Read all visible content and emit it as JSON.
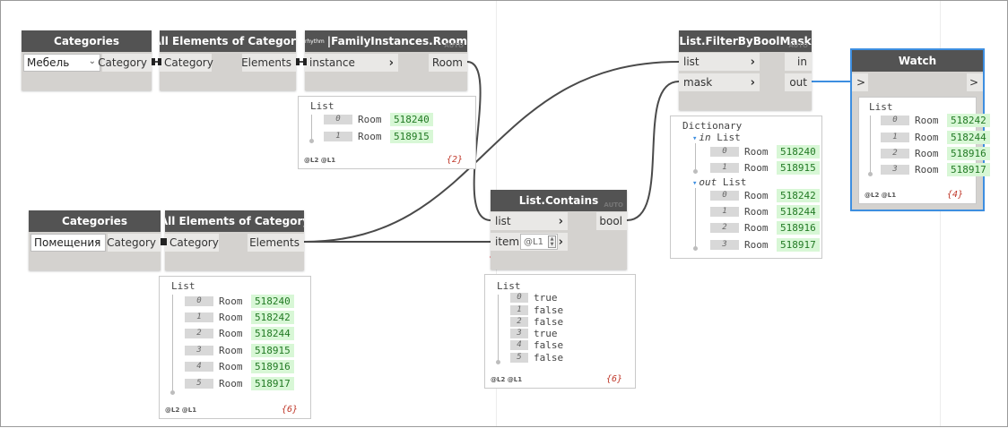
{
  "nodes": {
    "categories1": {
      "title": "Categories",
      "dropdown_value": "Мебель",
      "output_port": "Category"
    },
    "all_elements1": {
      "title": "All Elements of Category",
      "input_port": "Category",
      "output_port": "Elements"
    },
    "family_instances": {
      "title_prefix": "rhythm",
      "title": "|FamilyInstances.Room",
      "input_port": "instance",
      "output_port": "Room",
      "lacing": "AUTO"
    },
    "categories2": {
      "title": "Categories",
      "dropdown_value": "Помещения",
      "output_port": "Category"
    },
    "all_elements2": {
      "title": "All Elements of Category",
      "input_port": "Category",
      "output_port": "Elements"
    },
    "list_contains": {
      "title": "List.Contains",
      "input_port_list": "list",
      "input_port_item": "item",
      "item_lacing": "@L1",
      "output_port": "bool",
      "lacing": "AUTO"
    },
    "filter_by_bool_mask": {
      "title": "List.FilterByBoolMask",
      "input_port_list": "list",
      "input_port_mask": "mask",
      "output_port_in": "in",
      "output_port_out": "out",
      "lacing": "AUTO"
    },
    "watch": {
      "title": "Watch",
      "input_port": ">",
      "output_port": ">"
    }
  },
  "previews": {
    "family_instances": {
      "title": "List",
      "items": [
        {
          "index": "0",
          "label": "Room",
          "value": "518240"
        },
        {
          "index": "1",
          "label": "Room",
          "value": "518915"
        }
      ],
      "levels": "@L2 @L1",
      "count": "{2}"
    },
    "all_elements2": {
      "title": "List",
      "items": [
        {
          "index": "0",
          "label": "Room",
          "value": "518240"
        },
        {
          "index": "1",
          "label": "Room",
          "value": "518242"
        },
        {
          "index": "2",
          "label": "Room",
          "value": "518244"
        },
        {
          "index": "3",
          "label": "Room",
          "value": "518915"
        },
        {
          "index": "4",
          "label": "Room",
          "value": "518916"
        },
        {
          "index": "5",
          "label": "Room",
          "value": "518917"
        }
      ],
      "levels": "@L2 @L1",
      "count": "{6}"
    },
    "list_contains": {
      "title": "List",
      "items": [
        {
          "index": "0",
          "value": "true"
        },
        {
          "index": "1",
          "value": "false"
        },
        {
          "index": "2",
          "value": "false"
        },
        {
          "index": "3",
          "value": "true"
        },
        {
          "index": "4",
          "value": "false"
        },
        {
          "index": "5",
          "value": "false"
        }
      ],
      "levels": "@L2 @L1",
      "count": "{6}"
    },
    "filter_by_bool_mask": {
      "title": "Dictionary",
      "in_key": "in",
      "in_title": "List",
      "in_items": [
        {
          "index": "0",
          "label": "Room",
          "value": "518240"
        },
        {
          "index": "1",
          "label": "Room",
          "value": "518915"
        }
      ],
      "out_key": "out",
      "out_title": "List",
      "out_items": [
        {
          "index": "0",
          "label": "Room",
          "value": "518242"
        },
        {
          "index": "1",
          "label": "Room",
          "value": "518244"
        },
        {
          "index": "2",
          "label": "Room",
          "value": "518916"
        },
        {
          "index": "3",
          "label": "Room",
          "value": "518917"
        }
      ]
    },
    "watch": {
      "title": "List",
      "items": [
        {
          "index": "0",
          "label": "Room",
          "value": "518242"
        },
        {
          "index": "1",
          "label": "Room",
          "value": "518244"
        },
        {
          "index": "2",
          "label": "Room",
          "value": "518916"
        },
        {
          "index": "3",
          "label": "Room",
          "value": "518917"
        }
      ],
      "levels": "@L2 @L1",
      "count": "{4}"
    }
  },
  "colors": {
    "header": "#535353",
    "node_body": "#d4d2cf",
    "selection": "#3d8ee0",
    "value_bg": "#d8f7d6",
    "value_text": "#227a24",
    "annotation": "#e0262d"
  }
}
